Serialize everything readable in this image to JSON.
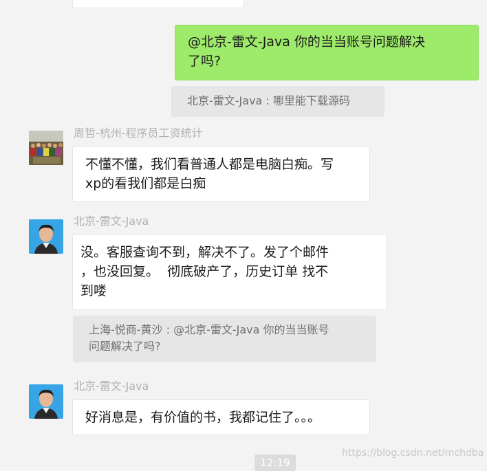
{
  "chat": {
    "messages": [
      {
        "type": "self",
        "text": "@北京-雷文-Java 你的当当账号问题解决\n了吗?"
      },
      {
        "type": "quote",
        "text": "北京-雷文-Java : 哪里能下载源码"
      },
      {
        "type": "incoming",
        "sender": "周哲-杭州-程序员工资统计",
        "text": "不懂不懂，我们看普通人都是电脑白痴。写\nxp的看我们都是白痴"
      },
      {
        "type": "incoming",
        "sender": "北京-雷文-Java",
        "text": "没。客服查询不到，解决不了。发了个邮件\n，也没回复。  彻底破产了，历史订单 找不\n到喽"
      },
      {
        "type": "quote",
        "text": "上海-悦商-黄沙 : @北京-雷文-Java 你的当当账号\n问题解决了吗?"
      },
      {
        "type": "incoming",
        "sender": "北京-雷文-Java",
        "text": "好消息是，有价值的书，我都记住了。。。"
      }
    ],
    "timestamp": "12:19"
  },
  "watermark": "https://blog.csdn.net/mchdba",
  "colors": {
    "background": "#f3f3f3",
    "self_bubble": "#9eea6a",
    "incoming_bubble": "#ffffff",
    "quote_bg": "#e6e6e6"
  },
  "icons": [
    "avatar-group-photo",
    "avatar-man-photo"
  ]
}
